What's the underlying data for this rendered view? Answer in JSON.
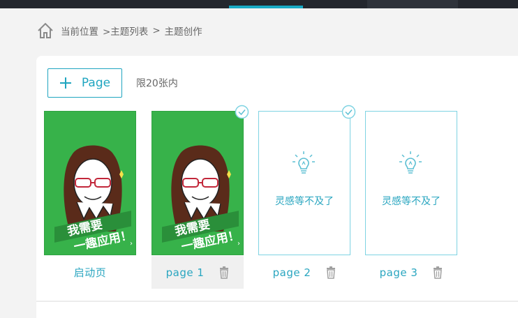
{
  "breadcrumb": {
    "items": [
      "当前位置",
      ">主题列表",
      ">",
      "主题创作"
    ]
  },
  "toolbar": {
    "add_page_label": "Page",
    "limit_text": "限20张内"
  },
  "pages": [
    {
      "label": "启动页",
      "thumbnail": "avatar-art",
      "caption_art": "我需要 一趣应用！",
      "selected": false,
      "checked": false
    },
    {
      "label": "page 1",
      "thumbnail": "avatar-art",
      "caption_art": "我需要 一趣应用！",
      "selected": true,
      "checked": true
    },
    {
      "label": "page 2",
      "thumbnail": "empty",
      "empty_text": "灵感等不及了",
      "selected": false,
      "checked": true
    },
    {
      "label": "page 3",
      "thumbnail": "empty",
      "empty_text": "灵感等不及了",
      "selected": false,
      "checked": false
    }
  ],
  "colors": {
    "accent": "#1fa5c0",
    "thumb_green": "#37b24a",
    "topbar": "#24272e"
  },
  "icons": [
    "home-icon",
    "plus-icon",
    "check-icon",
    "bulb-icon",
    "trash-icon"
  ]
}
